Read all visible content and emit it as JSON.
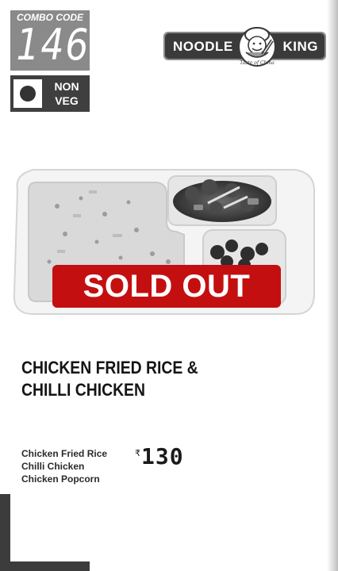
{
  "combo": {
    "label": "COMBO CODE",
    "code": "146"
  },
  "diet": {
    "line1": "NON",
    "line2": "VEG"
  },
  "brand": {
    "left": "NOODLE",
    "right": "KING",
    "tagline": "Taste of China"
  },
  "status": {
    "label": "SOLD OUT"
  },
  "product": {
    "title_line1": "CHICKEN FRIED RICE &",
    "title_line2": "CHILLI CHICKEN",
    "items": [
      "Chicken Fried Rice",
      "Chilli Chicken",
      "Chicken Popcorn"
    ]
  },
  "price": {
    "currency": "₹",
    "amount": "130"
  },
  "colors": {
    "sold_out": "#c40f10",
    "dark": "#3c3c3c",
    "badge": "#8a8a8a"
  },
  "icons": {
    "diet": "non-veg-dot-icon",
    "mascot": "chef-mascot-icon"
  }
}
